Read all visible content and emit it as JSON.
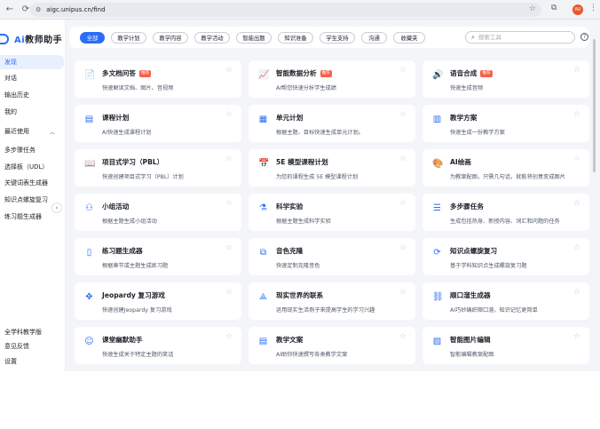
{
  "browser": {
    "url": "aigc.unipus.cn/find",
    "profile_initials": "AU"
  },
  "sidebar": {
    "logo_ai": "Ai",
    "logo_rest": "教师助手",
    "items": [
      {
        "label": "发现",
        "active": true
      },
      {
        "label": "对话"
      },
      {
        "label": "输出历史"
      },
      {
        "label": "我的"
      },
      {
        "label": "最近使用"
      },
      {
        "label": "多步骤任务"
      },
      {
        "label": "选择板（UDL）"
      },
      {
        "label": "关键词表生成器"
      },
      {
        "label": "知识点螺旋复习"
      },
      {
        "label": "练习题生成器"
      }
    ],
    "bottom": [
      {
        "label": "全学科教学版"
      },
      {
        "label": "意见反馈"
      },
      {
        "label": "设置"
      }
    ]
  },
  "filters": [
    "全部",
    "教学计划",
    "教学内容",
    "教学活动",
    "智能出题",
    "知识准备",
    "学生支持",
    "沟通",
    "收藏夹"
  ],
  "search": {
    "placeholder": "搜索工具"
  },
  "cards": [
    {
      "title": "多文档问答",
      "badge": "推荐",
      "desc": "快速解读文档、图片、音视频",
      "icon": "doc-question-icon",
      "glyph": "📄"
    },
    {
      "title": "智能数据分析",
      "badge": "推荐",
      "desc": "AI帮您快速分析学生成绩",
      "icon": "chart-icon",
      "glyph": "📈"
    },
    {
      "title": "语音合成",
      "badge": "推荐",
      "desc": "快速生成音频",
      "icon": "audio-file-icon",
      "glyph": "🔊"
    },
    {
      "title": "课程计划",
      "badge": "",
      "desc": "AI快速生成课程计划",
      "icon": "lesson-plan-icon",
      "glyph": "▤"
    },
    {
      "title": "单元计划",
      "badge": "",
      "desc": "根据主题、目标快速生成单元计划。",
      "icon": "unit-plan-icon",
      "glyph": "▦"
    },
    {
      "title": "教学方案",
      "badge": "",
      "desc": "快速生成一份教学方案",
      "icon": "library-icon",
      "glyph": "▥"
    },
    {
      "title": "项目式学习（PBL）",
      "badge": "",
      "desc": "快速创建项目式学习（PBL）计划",
      "icon": "book-open-icon",
      "glyph": "📖"
    },
    {
      "title": "5E 模型课程计划",
      "badge": "",
      "desc": "为您的课程生成 5E 模型课程计划",
      "icon": "calendar-check-icon",
      "glyph": "📅"
    },
    {
      "title": "AI绘画",
      "badge": "",
      "desc": "为教案配图，只需几句话，就能将创意变成图片",
      "icon": "palette-icon",
      "glyph": "🎨"
    },
    {
      "title": "小组活动",
      "badge": "",
      "desc": "根据主题生成小组活动",
      "icon": "group-icon",
      "glyph": "⚇"
    },
    {
      "title": "科学实验",
      "badge": "",
      "desc": "根据主题生成科学实验",
      "icon": "flask-icon",
      "glyph": "⚗"
    },
    {
      "title": "多步骤任务",
      "badge": "",
      "desc": "生成包括热身、新授内容、词汇和问题的任务",
      "icon": "list-icon",
      "glyph": "☰"
    },
    {
      "title": "练习题生成器",
      "badge": "",
      "desc": "根据章节或主题生成练习题",
      "icon": "notebook-icon",
      "glyph": "▯"
    },
    {
      "title": "音色克隆",
      "badge": "",
      "desc": "快速定制克隆音色",
      "icon": "copy-icon",
      "glyph": "⧉"
    },
    {
      "title": "知识点螺旋复习",
      "badge": "",
      "desc": "基于学科知识点生成螺旋复习题",
      "icon": "spiral-icon",
      "glyph": "⟳"
    },
    {
      "title": "Jeopardy 复习游戏",
      "badge": "",
      "desc": "快速创建Jeopardy 复习游戏",
      "icon": "gamepad-icon",
      "glyph": "✥"
    },
    {
      "title": "现实世界的联系",
      "badge": "",
      "desc": "运用现实生活例子来提高学生的学习兴趣",
      "icon": "network-icon",
      "glyph": "⟁"
    },
    {
      "title": "顺口溜生成器",
      "badge": "",
      "desc": "AI巧妙编织顺口溜，知识记忆更简单",
      "icon": "link-icon",
      "glyph": "⛓"
    },
    {
      "title": "课堂幽默助手",
      "badge": "",
      "desc": "快速生成关于特定主题的笑话",
      "icon": "smile-icon",
      "glyph": "☺"
    },
    {
      "title": "教学文案",
      "badge": "",
      "desc": "AI助你快速撰写各类教学文案",
      "icon": "document-icon",
      "glyph": "▤"
    },
    {
      "title": "智能图片编辑",
      "badge": "",
      "desc": "智能编辑教案配图",
      "icon": "image-edit-icon",
      "glyph": "▨"
    }
  ],
  "colors": {
    "accent": "#2b6ef6",
    "badge": "#f7604a",
    "background": "#f3f5f9"
  }
}
